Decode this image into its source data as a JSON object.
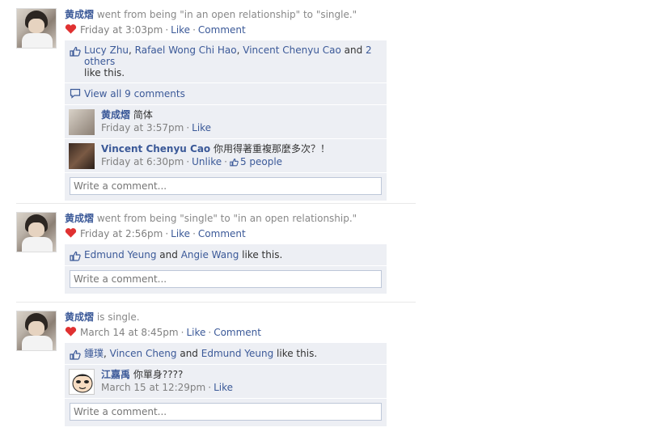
{
  "stories": [
    {
      "actor": "黄成熠",
      "action": "went from being \"in an open relationship\" to \"single.\"",
      "time": "Friday at 3:03pm",
      "like": "Like",
      "comment": "Comment",
      "likes_line": {
        "names": [
          "Lucy Zhu",
          "Rafael Wong Chi Hao",
          "Vincent Chenyu Cao"
        ],
        "sep1": ", ",
        "sep2": ", ",
        "and": " and ",
        "others": "2 others",
        "tail": "like this."
      },
      "view_all": "View all 9 comments",
      "comments": [
        {
          "author": "黄成熠",
          "text": "简体",
          "time": "Friday at 3:57pm",
          "action": "Like"
        },
        {
          "author": "Vincent Chenyu Cao",
          "text": "你用得著重複那麼多次？！",
          "time": "Friday at 6:30pm",
          "action": "Unlike",
          "people": "5 people"
        }
      ],
      "write_placeholder": "Write a comment..."
    },
    {
      "actor": "黄成熠",
      "action": "went from being \"single\" to \"in an open relationship.\"",
      "time": "Friday at 2:56pm",
      "like": "Like",
      "comment": "Comment",
      "likes_line": {
        "name1": "Edmund Yeung",
        "and": " and ",
        "name2": "Angie Wang",
        "tail": " like this."
      },
      "write_placeholder": "Write a comment..."
    },
    {
      "actor": "黄成熠",
      "action": "is single.",
      "time": "March 14 at 8:45pm",
      "like": "Like",
      "comment": "Comment",
      "likes_line": {
        "name1": "鍾璞",
        "sep": ", ",
        "name2": "Vincen Cheng",
        "and": " and ",
        "name3": "Edmund Yeung",
        "tail": " like this."
      },
      "comments": [
        {
          "author": "江嘉禹",
          "text": "你單身????",
          "time": "March 15 at 12:29pm",
          "action": "Like"
        }
      ],
      "write_placeholder": "Write a comment..."
    }
  ],
  "dot": "·",
  "colors": {
    "link": "#3b5998",
    "ufi_bg": "#edeff4",
    "muted": "#808080",
    "heart": "#e03131"
  }
}
